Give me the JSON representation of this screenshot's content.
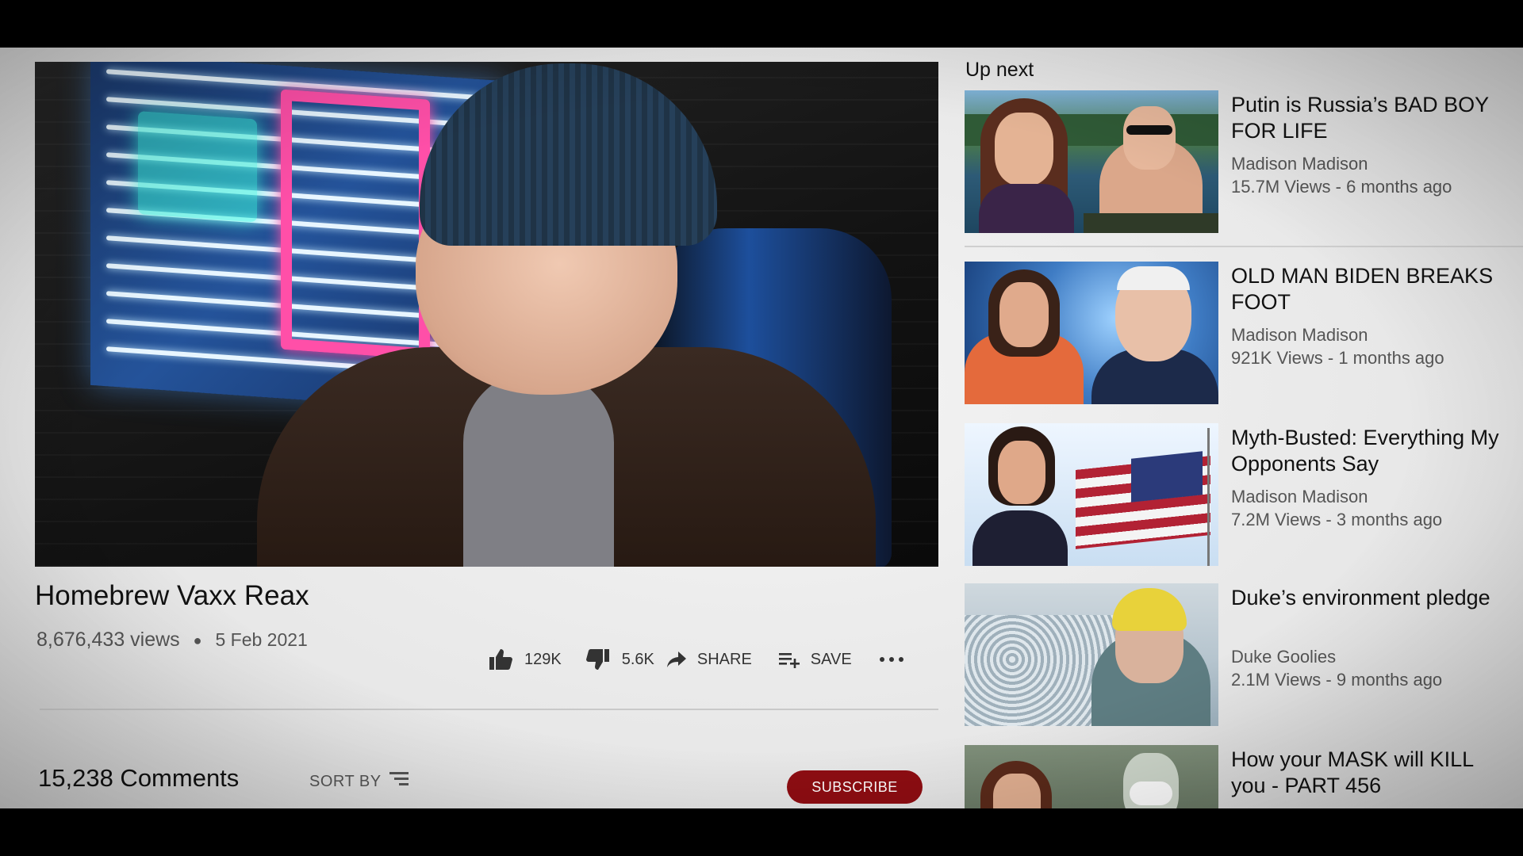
{
  "video": {
    "title": "Homebrew Vaxx Reax",
    "views": "8,676,433 views",
    "date": "5 Feb 2021"
  },
  "actions": {
    "likes": "129K",
    "dislikes": "5.6K",
    "share_label": "SHARE",
    "save_label": "SAVE"
  },
  "comments": {
    "count_label": "15,238 Comments",
    "sort_label": "SORT BY"
  },
  "subscribe_label": "SUBSCRIBE",
  "sidebar": {
    "heading": "Up next",
    "items": [
      {
        "title": "Putin is Russia’s BAD BOY FOR LIFE",
        "channel": "Madison Madison",
        "stats": "15.7M Views - 6 months ago"
      },
      {
        "title": "OLD MAN BIDEN BREAKS FOOT",
        "channel": "Madison Madison",
        "stats": "921K Views - 1 months ago"
      },
      {
        "title": "Myth-Busted: Everything My Opponents Say",
        "channel": "Madison Madison",
        "stats": "7.2M Views - 3 months ago"
      },
      {
        "title": "Duke’s environment pledge",
        "channel": "Duke Goolies",
        "stats": "2.1M Views - 9 months ago"
      },
      {
        "title": "How your MASK will KILL you - PART 456",
        "channel": "",
        "stats": ""
      }
    ]
  },
  "colors": {
    "subscribe": "#8e0d12",
    "page_bg": "#ececec",
    "text": "#111111",
    "muted": "#555555"
  },
  "icons": [
    "thumbs-up-icon",
    "thumbs-down-icon",
    "share-icon",
    "playlist-add-icon",
    "more-icon",
    "sort-icon"
  ]
}
